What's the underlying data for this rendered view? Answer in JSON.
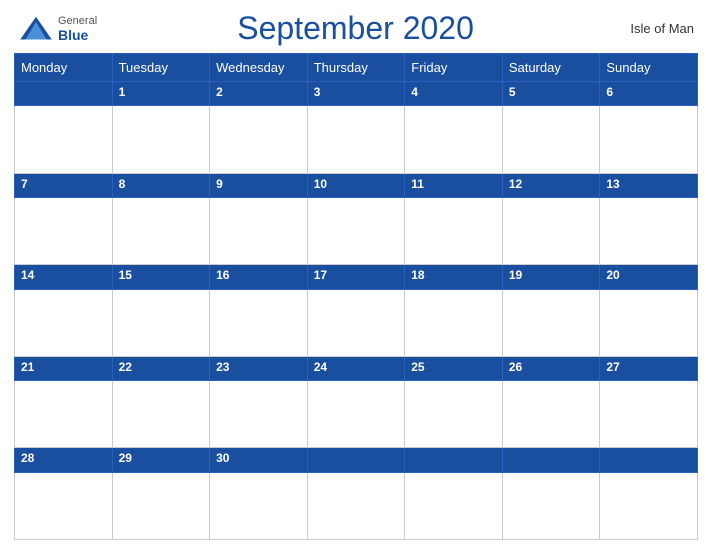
{
  "header": {
    "logo_general": "General",
    "logo_blue": "Blue",
    "title": "September 2020",
    "region": "Isle of Man"
  },
  "weekdays": [
    "Monday",
    "Tuesday",
    "Wednesday",
    "Thursday",
    "Friday",
    "Saturday",
    "Sunday"
  ],
  "weeks": [
    {
      "numbers": [
        "",
        "1",
        "2",
        "3",
        "4",
        "5",
        "6"
      ]
    },
    {
      "numbers": [
        "7",
        "8",
        "9",
        "10",
        "11",
        "12",
        "13"
      ]
    },
    {
      "numbers": [
        "14",
        "15",
        "16",
        "17",
        "18",
        "19",
        "20"
      ]
    },
    {
      "numbers": [
        "21",
        "22",
        "23",
        "24",
        "25",
        "26",
        "27"
      ]
    },
    {
      "numbers": [
        "28",
        "29",
        "30",
        "",
        "",
        "",
        ""
      ]
    }
  ]
}
